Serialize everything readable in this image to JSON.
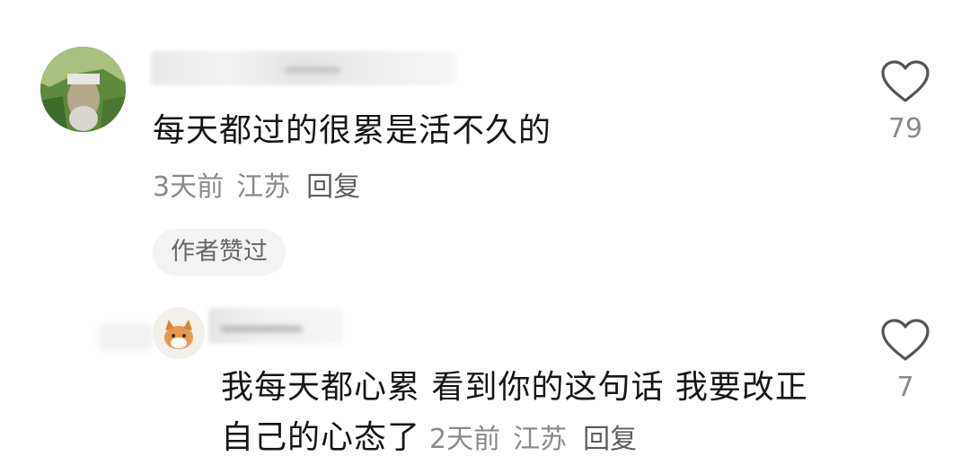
{
  "comment": {
    "text": "每天都过的很累是活不久的",
    "time": "3天前",
    "location": "江苏",
    "reply_label": "回复",
    "author_badge": "作者赞过",
    "likes": "79"
  },
  "reply": {
    "text": "我每天都心累 看到你的这句话 我要改正自己的心态了",
    "time": "2天前",
    "location": "江苏",
    "reply_label": "回复",
    "likes": "7"
  },
  "colors": {
    "text_primary": "#161616",
    "text_secondary": "#8a8a8a",
    "badge_bg": "#f3f3f3",
    "heart_stroke": "#555555"
  },
  "icons": [
    "heart-outline-icon"
  ]
}
